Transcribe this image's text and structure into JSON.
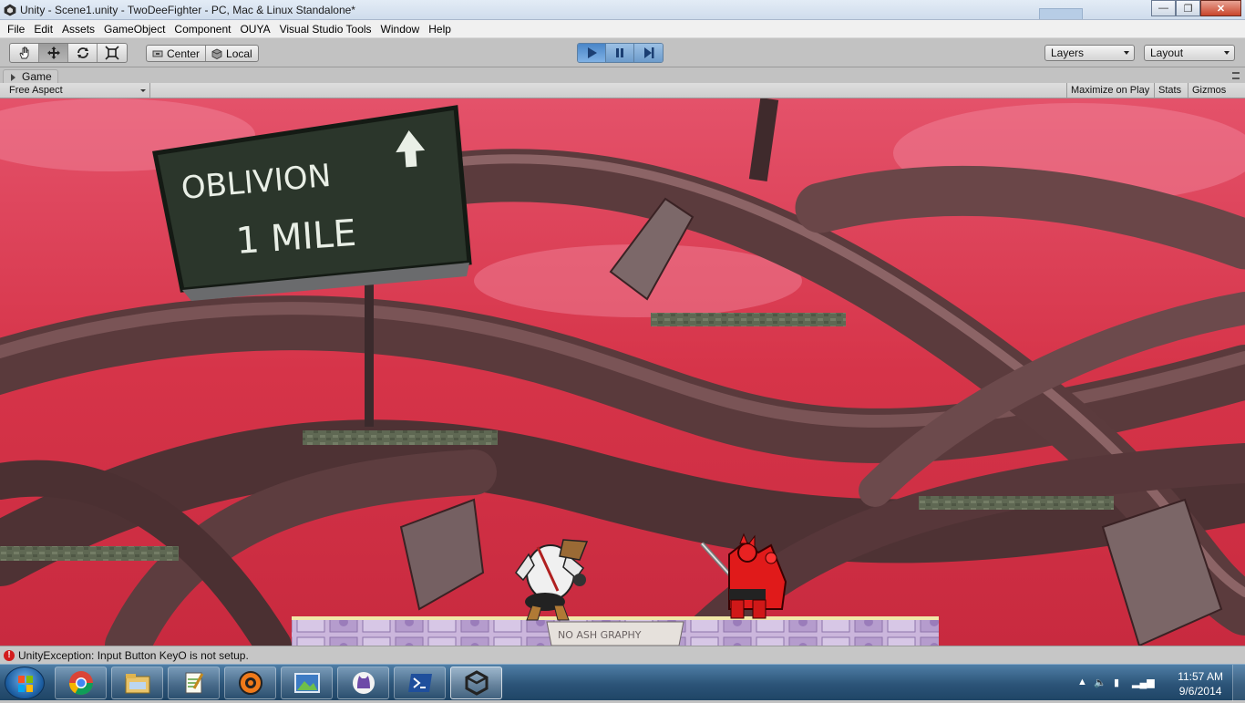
{
  "window": {
    "title": "Unity - Scene1.unity - TwoDeeFighter - PC, Mac & Linux Standalone*",
    "controls": {
      "minimize": "—",
      "maximize": "❐",
      "close": "✕"
    }
  },
  "menu": [
    "File",
    "Edit",
    "Assets",
    "GameObject",
    "Component",
    "OUYA",
    "Visual Studio Tools",
    "Window",
    "Help"
  ],
  "toolbar": {
    "transform_tools": [
      "hand-icon",
      "move-icon",
      "rotate-icon",
      "scale-icon"
    ],
    "active_tool": "move-icon",
    "pivot_label": "Center",
    "space_label": "Local",
    "play_state": "playing",
    "layers_label": "Layers",
    "layout_label": "Layout"
  },
  "game_panel": {
    "tab_label": "Game",
    "aspect_label": "Free Aspect",
    "maximize_label": "Maximize on Play",
    "stats_label": "Stats",
    "gizmos_label": "Gizmos"
  },
  "scene": {
    "sign_line1": "OBLIVION",
    "sign_line2": "1 MILE",
    "stage_sign": "NO ASH GRAPHY",
    "colors": {
      "sky": "#d8384c",
      "wood": "#5a3a3c",
      "sign": "#2e3a2c",
      "platform": "#5d6650",
      "stage": "#c9b2d8",
      "red_knight": "#e01a1a"
    }
  },
  "status": {
    "message": "UnityException: Input Button KeyO is not setup."
  },
  "taskbar": {
    "apps": [
      "chrome-icon",
      "explorer-icon",
      "notepad-icon",
      "game-icon",
      "image-icon",
      "github-icon",
      "powershell-icon",
      "unity-icon"
    ],
    "active_app": "unity-icon",
    "time": "11:57 AM",
    "date": "9/6/2014"
  }
}
